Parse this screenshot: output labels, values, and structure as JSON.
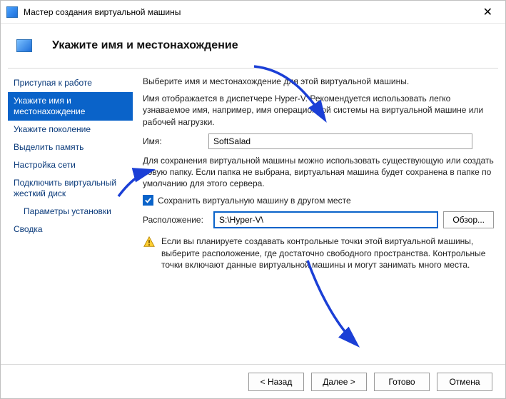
{
  "titlebar": {
    "title": "Мастер создания виртуальной машины"
  },
  "header": {
    "title": "Укажите имя и местонахождение"
  },
  "sidebar": {
    "items": [
      {
        "label": "Приступая к работе"
      },
      {
        "label": "Укажите имя и местонахождение"
      },
      {
        "label": "Укажите поколение"
      },
      {
        "label": "Выделить память"
      },
      {
        "label": "Настройка сети"
      },
      {
        "label": "Подключить виртуальный жесткий диск"
      },
      {
        "label": "Параметры установки"
      },
      {
        "label": "Сводка"
      }
    ]
  },
  "content": {
    "intro": "Выберите имя и местонахождение для этой виртуальной машины.",
    "name_hint": "Имя отображается в диспетчере Hyper-V. Рекомендуется использовать легко узнаваемое имя, например, имя операционной системы на виртуальной машине или рабочей нагрузки.",
    "name_label": "Имя:",
    "name_value": "SoftSalad",
    "store_hint": "Для сохранения виртуальной машины можно использовать существующую или создать новую папку. Если папка не выбрана, виртуальная машина будет сохранена в папке по умолчанию для этого сервера.",
    "checkbox_label": "Сохранить виртуальную машину в другом месте",
    "checkbox_checked": true,
    "location_label": "Расположение:",
    "location_value": "S:\\Hyper-V\\",
    "browse_label": "Обзор...",
    "warning": "Если вы планируете создавать контрольные точки этой виртуальной машины, выберите расположение, где достаточно свободного пространства. Контрольные точки включают данные виртуальной машины и могут занимать много места."
  },
  "footer": {
    "back": "< Назад",
    "next": "Далее >",
    "finish": "Готово",
    "cancel": "Отмена"
  }
}
